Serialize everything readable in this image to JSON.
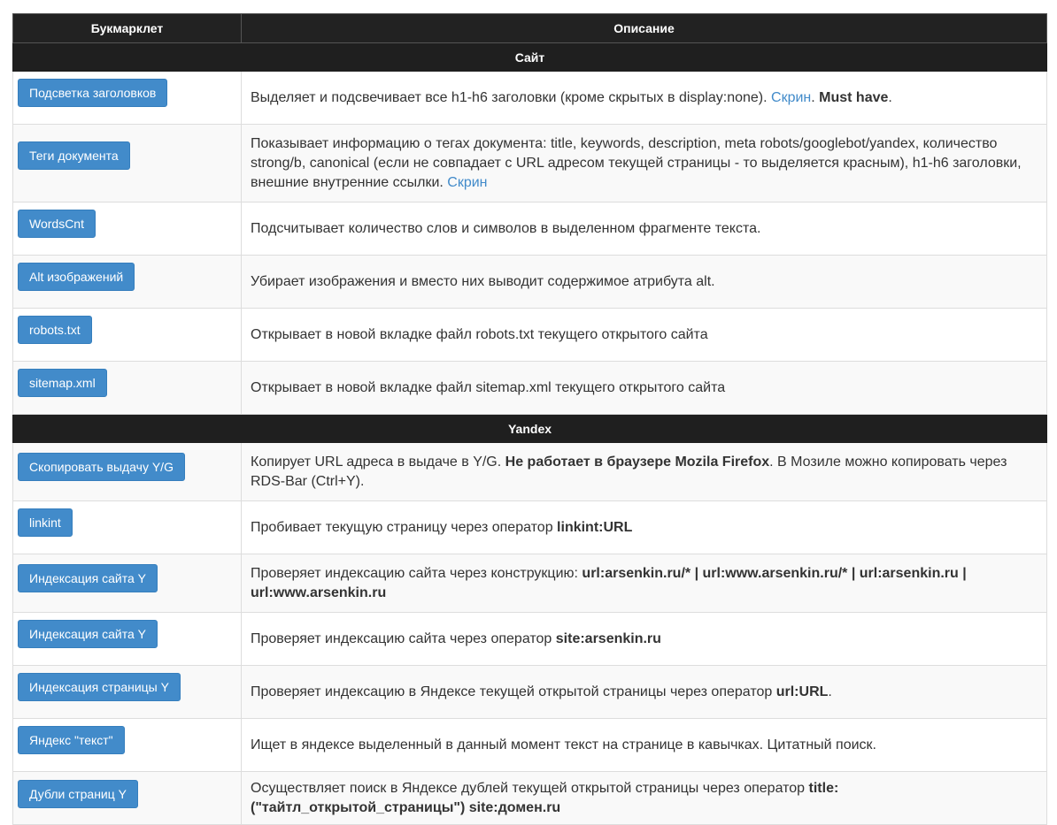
{
  "header": {
    "col_bookmarklet": "Букмарклет",
    "col_description": "Описание"
  },
  "section_site": "Сайт",
  "section_yandex": "Yandex",
  "rows_site": [
    {
      "button": "Подсветка заголовков",
      "desc_text": "Выделяет и подсвечивает все h1-h6 заголовки (кроме скрытых в display:none). ",
      "link": "Скрин",
      "after_link": ". ",
      "bold": "Must have",
      "tail": "."
    },
    {
      "button": "Теги документа",
      "desc_text": "Показывает информацию о тегах документа: title, keywords, description, meta robots/googlebot/yandex, количество strong/b, canonical (если не совпадает с URL адресом текущей страницы - то выделяется красным), h1-h6 заголовки, внешние внутренние ссылки. ",
      "link": "Скрин"
    },
    {
      "button": "WordsCnt",
      "desc_text": "Подсчитывает количество слов и символов в выделенном фрагменте текста."
    },
    {
      "button": "Alt изображений",
      "desc_text": "Убирает изображения и вместо них выводит содержимое атрибута alt."
    },
    {
      "button": "robots.txt",
      "desc_text": "Открывает в новой вкладке файл robots.txt текущего открытого сайта"
    },
    {
      "button": "sitemap.xml",
      "desc_text": "Открывает в новой вкладке файл sitemap.xml текущего открытого сайта"
    }
  ],
  "rows_yandex": [
    {
      "button": "Скопировать выдачу Y/G",
      "desc_text": "Копирует URL адреса в выдаче в Y/G. ",
      "bold": "Не работает в браузере Mozila Firefox",
      "tail": ". В Мозиле можно копировать через RDS-Bar (Ctrl+Y)."
    },
    {
      "button": "linkint",
      "desc_text": "Пробивает текущую страницу через оператор ",
      "bold": "linkint:URL"
    },
    {
      "button": "Индексация сайта Y",
      "desc_text": "Проверяет индексацию сайта через конструкцию: ",
      "bold": "url:arsenkin.ru/* | url:www.arsenkin.ru/* | url:arsenkin.ru | url:www.arsenkin.ru"
    },
    {
      "button": "Индексация сайта Y",
      "desc_text": "Проверяет индексацию сайта через оператор ",
      "bold": "site:arsenkin.ru"
    },
    {
      "button": "Индексация страницы Y",
      "desc_text": "Проверяет индексацию в Яндексе текущей открытой страницы через оператор ",
      "bold": "url:URL",
      "tail": "."
    },
    {
      "button": "Яндекс \"текст\"",
      "desc_text": "Ищет в яндексе выделенный в данный момент текст на странице в кавычках. Цитатный поиск."
    },
    {
      "button": "Дубли страниц Y",
      "desc_text": "Осуществляет поиск в Яндексе дублей текущей открытой страницы через оператор ",
      "bold": "title:(\"тайтл_открытой_страницы\") site:домен.ru"
    }
  ],
  "colors": {
    "header_bg": "#222222",
    "button_bg": "#428bca",
    "link": "#428bca",
    "row_alt_bg": "#f9f9f9"
  }
}
